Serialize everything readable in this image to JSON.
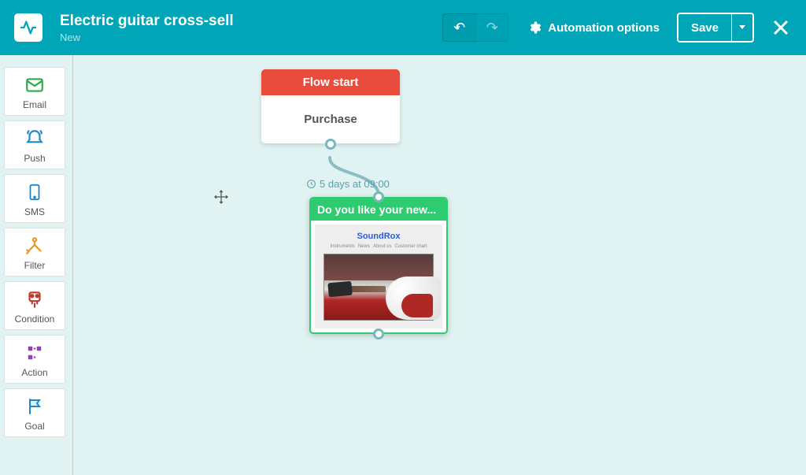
{
  "header": {
    "title": "Electric guitar cross-sell",
    "status": "New",
    "options_label": "Automation options",
    "save_label": "Save"
  },
  "palette": [
    {
      "key": "email",
      "label": "Email",
      "color": "#2bab4a"
    },
    {
      "key": "push",
      "label": "Push",
      "color": "#1e88c9"
    },
    {
      "key": "sms",
      "label": "SMS",
      "color": "#1e88c9"
    },
    {
      "key": "filter",
      "label": "Filter",
      "color": "#e69a1f"
    },
    {
      "key": "condition",
      "label": "Condition",
      "color": "#c0392b"
    },
    {
      "key": "action",
      "label": "Action",
      "color": "#8e44ad"
    },
    {
      "key": "goal",
      "label": "Goal",
      "color": "#1e88c9"
    }
  ],
  "flow": {
    "start": {
      "header_label": "Flow start",
      "trigger_label": "Purchase"
    },
    "delay": {
      "label": "5 days at 09:00"
    },
    "email_node": {
      "title": "Do you like your new...",
      "preview_brand": "SoundRox",
      "preview_nav": [
        "Instruments",
        "News",
        "About us",
        "Customer chart"
      ]
    }
  },
  "colors": {
    "primary": "#00a6b8",
    "flow_start_header": "#e74c3c",
    "email_header": "#2ecc71",
    "connector": "#8abec3"
  }
}
